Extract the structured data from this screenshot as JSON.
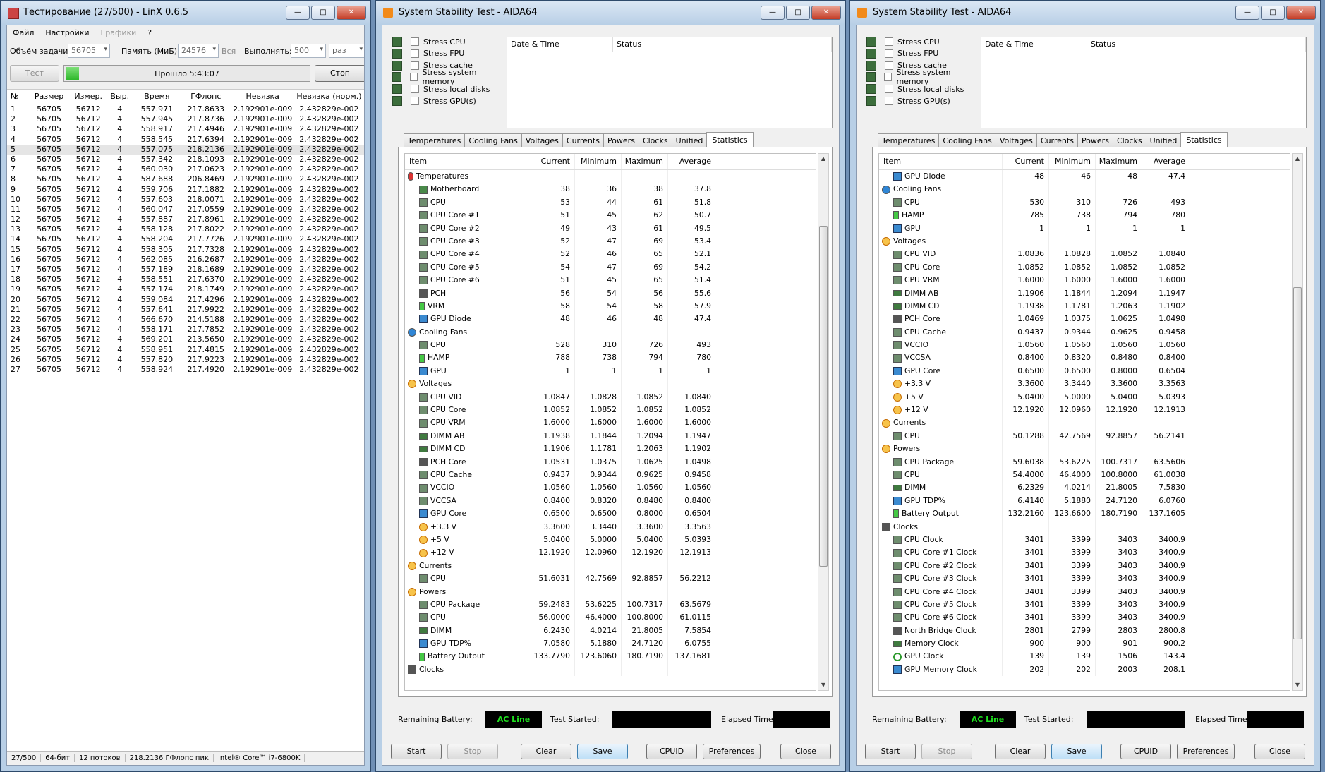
{
  "linx": {
    "title": "Тестирование (27/500) - LinX 0.6.5",
    "menu": [
      "Файл",
      "Настройки",
      "Графики",
      "?"
    ],
    "opts": {
      "size_label": "Объём задачи:",
      "size_value": "56705",
      "mem_label": "Память (МиБ):",
      "mem_value": "24576",
      "all_label": "Вся",
      "run_label": "Выполнять:",
      "run_value": "500",
      "run_unit": "раз"
    },
    "test_button": "Тест",
    "stop_button": "Стоп",
    "progress_text": "Прошло 5:43:07",
    "progress_fraction": 0.054,
    "columns": [
      "№",
      "Размер",
      "Измер.",
      "Выр.",
      "Время",
      "ГФлопс",
      "Невязка",
      "Невязка (норм.)"
    ],
    "rows": [
      [
        "1",
        "56705",
        "56712",
        "4",
        "557.971",
        "217.8633",
        "2.192901e-009",
        "2.432829e-002"
      ],
      [
        "2",
        "56705",
        "56712",
        "4",
        "557.945",
        "217.8736",
        "2.192901e-009",
        "2.432829e-002"
      ],
      [
        "3",
        "56705",
        "56712",
        "4",
        "558.917",
        "217.4946",
        "2.192901e-009",
        "2.432829e-002"
      ],
      [
        "4",
        "56705",
        "56712",
        "4",
        "558.545",
        "217.6394",
        "2.192901e-009",
        "2.432829e-002"
      ],
      [
        "5",
        "56705",
        "56712",
        "4",
        "557.075",
        "218.2136",
        "2.192901e-009",
        "2.432829e-002"
      ],
      [
        "6",
        "56705",
        "56712",
        "4",
        "557.342",
        "218.1093",
        "2.192901e-009",
        "2.432829e-002"
      ],
      [
        "7",
        "56705",
        "56712",
        "4",
        "560.030",
        "217.0623",
        "2.192901e-009",
        "2.432829e-002"
      ],
      [
        "8",
        "56705",
        "56712",
        "4",
        "587.688",
        "206.8469",
        "2.192901e-009",
        "2.432829e-002"
      ],
      [
        "9",
        "56705",
        "56712",
        "4",
        "559.706",
        "217.1882",
        "2.192901e-009",
        "2.432829e-002"
      ],
      [
        "10",
        "56705",
        "56712",
        "4",
        "557.603",
        "218.0071",
        "2.192901e-009",
        "2.432829e-002"
      ],
      [
        "11",
        "56705",
        "56712",
        "4",
        "560.047",
        "217.0559",
        "2.192901e-009",
        "2.432829e-002"
      ],
      [
        "12",
        "56705",
        "56712",
        "4",
        "557.887",
        "217.8961",
        "2.192901e-009",
        "2.432829e-002"
      ],
      [
        "13",
        "56705",
        "56712",
        "4",
        "558.128",
        "217.8022",
        "2.192901e-009",
        "2.432829e-002"
      ],
      [
        "14",
        "56705",
        "56712",
        "4",
        "558.204",
        "217.7726",
        "2.192901e-009",
        "2.432829e-002"
      ],
      [
        "15",
        "56705",
        "56712",
        "4",
        "558.305",
        "217.7328",
        "2.192901e-009",
        "2.432829e-002"
      ],
      [
        "16",
        "56705",
        "56712",
        "4",
        "562.085",
        "216.2687",
        "2.192901e-009",
        "2.432829e-002"
      ],
      [
        "17",
        "56705",
        "56712",
        "4",
        "557.189",
        "218.1689",
        "2.192901e-009",
        "2.432829e-002"
      ],
      [
        "18",
        "56705",
        "56712",
        "4",
        "558.551",
        "217.6370",
        "2.192901e-009",
        "2.432829e-002"
      ],
      [
        "19",
        "56705",
        "56712",
        "4",
        "557.174",
        "218.1749",
        "2.192901e-009",
        "2.432829e-002"
      ],
      [
        "20",
        "56705",
        "56712",
        "4",
        "559.084",
        "217.4296",
        "2.192901e-009",
        "2.432829e-002"
      ],
      [
        "21",
        "56705",
        "56712",
        "4",
        "557.641",
        "217.9922",
        "2.192901e-009",
        "2.432829e-002"
      ],
      [
        "22",
        "56705",
        "56712",
        "4",
        "566.670",
        "214.5188",
        "2.192901e-009",
        "2.432829e-002"
      ],
      [
        "23",
        "56705",
        "56712",
        "4",
        "558.171",
        "217.7852",
        "2.192901e-009",
        "2.432829e-002"
      ],
      [
        "24",
        "56705",
        "56712",
        "4",
        "569.201",
        "213.5650",
        "2.192901e-009",
        "2.432829e-002"
      ],
      [
        "25",
        "56705",
        "56712",
        "4",
        "558.951",
        "217.4815",
        "2.192901e-009",
        "2.432829e-002"
      ],
      [
        "26",
        "56705",
        "56712",
        "4",
        "557.820",
        "217.9223",
        "2.192901e-009",
        "2.432829e-002"
      ],
      [
        "27",
        "56705",
        "56712",
        "4",
        "558.924",
        "217.4920",
        "2.192901e-009",
        "2.432829e-002"
      ]
    ],
    "selected_row": 4,
    "status": [
      "27/500",
      "64-бит",
      "12 потоков",
      "218.2136 ГФлопс пик",
      "Intel® Core™ i7-6800K"
    ]
  },
  "aida_common": {
    "title": "System Stability Test - AIDA64",
    "stress": [
      "Stress CPU",
      "Stress FPU",
      "Stress cache",
      "Stress system memory",
      "Stress local disks",
      "Stress GPU(s)"
    ],
    "log_cols": [
      "Date & Time",
      "Status"
    ],
    "tabs": [
      "Temperatures",
      "Cooling Fans",
      "Voltages",
      "Currents",
      "Powers",
      "Clocks",
      "Unified",
      "Statistics"
    ],
    "active_tab": 7,
    "cols": [
      "Item",
      "Current",
      "Minimum",
      "Maximum",
      "Average"
    ],
    "remaining_label": "Remaining Battery:",
    "battery_value": "AC Line",
    "started_label": "Test Started:",
    "elapsed_label": "Elapsed Time:",
    "buttons": {
      "start": "Start",
      "stop": "Stop",
      "clear": "Clear",
      "save": "Save",
      "cpuid": "CPUID",
      "prefs": "Preferences",
      "close": "Close"
    }
  },
  "aida1_rows": [
    [
      "g",
      "therm",
      "Temperatures"
    ],
    [
      "i",
      "mobo",
      "Motherboard",
      "38",
      "36",
      "38",
      "37.8"
    ],
    [
      "i",
      "chip",
      "CPU",
      "53",
      "44",
      "61",
      "51.8"
    ],
    [
      "i",
      "chip",
      "CPU Core #1",
      "51",
      "45",
      "62",
      "50.7"
    ],
    [
      "i",
      "chip",
      "CPU Core #2",
      "49",
      "43",
      "61",
      "49.5"
    ],
    [
      "i",
      "chip",
      "CPU Core #3",
      "52",
      "47",
      "69",
      "53.4"
    ],
    [
      "i",
      "chip",
      "CPU Core #4",
      "52",
      "46",
      "65",
      "52.1"
    ],
    [
      "i",
      "chip",
      "CPU Core #5",
      "54",
      "47",
      "69",
      "54.2"
    ],
    [
      "i",
      "chip",
      "CPU Core #6",
      "51",
      "45",
      "65",
      "51.4"
    ],
    [
      "i",
      "clk",
      "PCH",
      "56",
      "54",
      "56",
      "55.6"
    ],
    [
      "i",
      "batt",
      "VRM",
      "58",
      "54",
      "58",
      "57.9"
    ],
    [
      "i",
      "gpu",
      "GPU Diode",
      "48",
      "46",
      "48",
      "47.4"
    ],
    [
      "g",
      "fan",
      "Cooling Fans"
    ],
    [
      "i",
      "chip",
      "CPU",
      "528",
      "310",
      "726",
      "493"
    ],
    [
      "i",
      "batt",
      "HAMP",
      "788",
      "738",
      "794",
      "780"
    ],
    [
      "i",
      "gpu",
      "GPU",
      "1",
      "1",
      "1",
      "1"
    ],
    [
      "g",
      "bolt",
      "Voltages"
    ],
    [
      "i",
      "chip",
      "CPU VID",
      "1.0847",
      "1.0828",
      "1.0852",
      "1.0840"
    ],
    [
      "i",
      "chip",
      "CPU Core",
      "1.0852",
      "1.0852",
      "1.0852",
      "1.0852"
    ],
    [
      "i",
      "chip",
      "CPU VRM",
      "1.6000",
      "1.6000",
      "1.6000",
      "1.6000"
    ],
    [
      "i",
      "ram",
      "DIMM AB",
      "1.1938",
      "1.1844",
      "1.2094",
      "1.1947"
    ],
    [
      "i",
      "ram",
      "DIMM CD",
      "1.1906",
      "1.1781",
      "1.2063",
      "1.1902"
    ],
    [
      "i",
      "clk",
      "PCH Core",
      "1.0531",
      "1.0375",
      "1.0625",
      "1.0498"
    ],
    [
      "i",
      "chip",
      "CPU Cache",
      "0.9437",
      "0.9344",
      "0.9625",
      "0.9458"
    ],
    [
      "i",
      "chip",
      "VCCIO",
      "1.0560",
      "1.0560",
      "1.0560",
      "1.0560"
    ],
    [
      "i",
      "chip",
      "VCCSA",
      "0.8400",
      "0.8320",
      "0.8480",
      "0.8400"
    ],
    [
      "i",
      "gpu",
      "GPU Core",
      "0.6500",
      "0.6500",
      "0.8000",
      "0.6504"
    ],
    [
      "i",
      "bolt",
      "+3.3 V",
      "3.3600",
      "3.3440",
      "3.3600",
      "3.3563"
    ],
    [
      "i",
      "bolt",
      "+5 V",
      "5.0400",
      "5.0000",
      "5.0400",
      "5.0393"
    ],
    [
      "i",
      "bolt",
      "+12 V",
      "12.1920",
      "12.0960",
      "12.1920",
      "12.1913"
    ],
    [
      "g",
      "bolt",
      "Currents"
    ],
    [
      "i",
      "chip",
      "CPU",
      "51.6031",
      "42.7569",
      "92.8857",
      "56.2212"
    ],
    [
      "g",
      "bolt",
      "Powers"
    ],
    [
      "i",
      "chip",
      "CPU Package",
      "59.2483",
      "53.6225",
      "100.7317",
      "63.5679"
    ],
    [
      "i",
      "chip",
      "CPU",
      "56.0000",
      "46.4000",
      "100.8000",
      "61.0115"
    ],
    [
      "i",
      "ram",
      "DIMM",
      "6.2430",
      "4.0214",
      "21.8005",
      "7.5854"
    ],
    [
      "i",
      "gpu",
      "GPU TDP%",
      "7.0580",
      "5.1880",
      "24.7120",
      "6.0755"
    ],
    [
      "i",
      "batt",
      "Battery Output",
      "133.7790",
      "123.6060",
      "180.7190",
      "137.1681"
    ],
    [
      "g",
      "clk",
      "Clocks"
    ]
  ],
  "aida2_rows": [
    [
      "i",
      "gpu",
      "GPU Diode",
      "48",
      "46",
      "48",
      "47.4"
    ],
    [
      "g",
      "fan",
      "Cooling Fans"
    ],
    [
      "i",
      "chip",
      "CPU",
      "530",
      "310",
      "726",
      "493"
    ],
    [
      "i",
      "batt",
      "HAMP",
      "785",
      "738",
      "794",
      "780"
    ],
    [
      "i",
      "gpu",
      "GPU",
      "1",
      "1",
      "1",
      "1"
    ],
    [
      "g",
      "bolt",
      "Voltages"
    ],
    [
      "i",
      "chip",
      "CPU VID",
      "1.0836",
      "1.0828",
      "1.0852",
      "1.0840"
    ],
    [
      "i",
      "chip",
      "CPU Core",
      "1.0852",
      "1.0852",
      "1.0852",
      "1.0852"
    ],
    [
      "i",
      "chip",
      "CPU VRM",
      "1.6000",
      "1.6000",
      "1.6000",
      "1.6000"
    ],
    [
      "i",
      "ram",
      "DIMM AB",
      "1.1906",
      "1.1844",
      "1.2094",
      "1.1947"
    ],
    [
      "i",
      "ram",
      "DIMM CD",
      "1.1938",
      "1.1781",
      "1.2063",
      "1.1902"
    ],
    [
      "i",
      "clk",
      "PCH Core",
      "1.0469",
      "1.0375",
      "1.0625",
      "1.0498"
    ],
    [
      "i",
      "chip",
      "CPU Cache",
      "0.9437",
      "0.9344",
      "0.9625",
      "0.9458"
    ],
    [
      "i",
      "chip",
      "VCCIO",
      "1.0560",
      "1.0560",
      "1.0560",
      "1.0560"
    ],
    [
      "i",
      "chip",
      "VCCSA",
      "0.8400",
      "0.8320",
      "0.8480",
      "0.8400"
    ],
    [
      "i",
      "gpu",
      "GPU Core",
      "0.6500",
      "0.6500",
      "0.8000",
      "0.6504"
    ],
    [
      "i",
      "bolt",
      "+3.3 V",
      "3.3600",
      "3.3440",
      "3.3600",
      "3.3563"
    ],
    [
      "i",
      "bolt",
      "+5 V",
      "5.0400",
      "5.0000",
      "5.0400",
      "5.0393"
    ],
    [
      "i",
      "bolt",
      "+12 V",
      "12.1920",
      "12.0960",
      "12.1920",
      "12.1913"
    ],
    [
      "g",
      "bolt",
      "Currents"
    ],
    [
      "i",
      "chip",
      "CPU",
      "50.1288",
      "42.7569",
      "92.8857",
      "56.2141"
    ],
    [
      "g",
      "bolt",
      "Powers"
    ],
    [
      "i",
      "chip",
      "CPU Package",
      "59.6038",
      "53.6225",
      "100.7317",
      "63.5606"
    ],
    [
      "i",
      "chip",
      "CPU",
      "54.4000",
      "46.4000",
      "100.8000",
      "61.0038"
    ],
    [
      "i",
      "ram",
      "DIMM",
      "6.2329",
      "4.0214",
      "21.8005",
      "7.5830"
    ],
    [
      "i",
      "gpu",
      "GPU TDP%",
      "6.4140",
      "5.1880",
      "24.7120",
      "6.0760"
    ],
    [
      "i",
      "batt",
      "Battery Output",
      "132.2160",
      "123.6600",
      "180.7190",
      "137.1605"
    ],
    [
      "g",
      "clk",
      "Clocks"
    ],
    [
      "i",
      "chip",
      "CPU Clock",
      "3401",
      "3399",
      "3403",
      "3400.9"
    ],
    [
      "i",
      "chip",
      "CPU Core #1 Clock",
      "3401",
      "3399",
      "3403",
      "3400.9"
    ],
    [
      "i",
      "chip",
      "CPU Core #2 Clock",
      "3401",
      "3399",
      "3403",
      "3400.9"
    ],
    [
      "i",
      "chip",
      "CPU Core #3 Clock",
      "3401",
      "3399",
      "3403",
      "3400.9"
    ],
    [
      "i",
      "chip",
      "CPU Core #4 Clock",
      "3401",
      "3399",
      "3403",
      "3400.9"
    ],
    [
      "i",
      "chip",
      "CPU Core #5 Clock",
      "3401",
      "3399",
      "3403",
      "3400.9"
    ],
    [
      "i",
      "chip",
      "CPU Core #6 Clock",
      "3401",
      "3399",
      "3403",
      "3400.9"
    ],
    [
      "i",
      "clk",
      "North Bridge Clock",
      "2801",
      "2799",
      "2803",
      "2800.8"
    ],
    [
      "i",
      "ram",
      "Memory Clock",
      "900",
      "900",
      "901",
      "900.2"
    ],
    [
      "i",
      "xb",
      "GPU Clock",
      "139",
      "139",
      "1506",
      "143.4"
    ],
    [
      "i",
      "gpu",
      "GPU Memory Clock",
      "202",
      "202",
      "2003",
      "208.1"
    ]
  ]
}
